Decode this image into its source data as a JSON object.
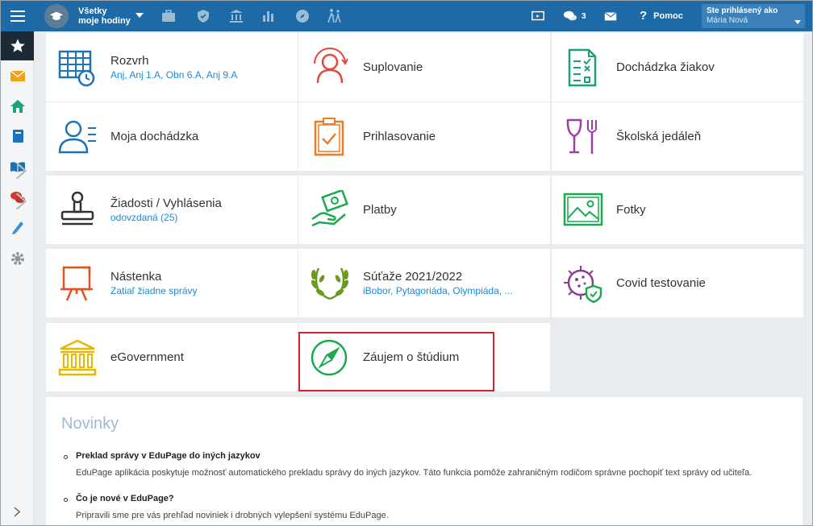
{
  "topbar": {
    "school_line1": "Všetky",
    "school_line2": "moje hodiny",
    "messages_count": "3",
    "help_label": "Pomoc",
    "login_label": "Ste prihlásený ako",
    "user_name": "Mária Nová"
  },
  "tiles": [
    {
      "title": "Rozvrh",
      "subtitle": "Anj, Anj 1.A, Obn 6.A, Anj 9.A",
      "icon": "timetable-icon",
      "color": "#1c72b8"
    },
    {
      "title": "Suplovanie",
      "subtitle": "",
      "icon": "substitution-icon",
      "color": "#e04b3f"
    },
    {
      "title": "Dochádzka žiakov",
      "subtitle": "",
      "icon": "attendance-list-icon",
      "color": "#1aa27a"
    },
    {
      "title": "Moja dochádzka",
      "subtitle": "",
      "icon": "my-attendance-icon",
      "color": "#1c72b8"
    },
    {
      "title": "Prihlasovanie",
      "subtitle": "",
      "icon": "clipboard-check-icon",
      "color": "#e87d2a"
    },
    {
      "title": "Školská jedáleň",
      "subtitle": "",
      "icon": "canteen-icon",
      "color": "#9b3fa6"
    },
    {
      "title": "Žiadosti / Vyhlásenia",
      "subtitle": "odovzdaná (25)",
      "icon": "stamp-icon",
      "color": "#2c3338"
    },
    {
      "title": "Platby",
      "subtitle": "",
      "icon": "payment-icon",
      "color": "#1aa94f"
    },
    {
      "title": "Fotky",
      "subtitle": "",
      "icon": "photo-icon",
      "color": "#1aa94f"
    },
    {
      "title": "Nástenka",
      "subtitle": "Zatiaľ žiadne správy",
      "icon": "noticeboard-icon",
      "color": "#e0531e"
    },
    {
      "title": "Súťaže 2021/2022",
      "subtitle": "iBobor, Pytagoriáda, Olympiáda, ...",
      "icon": "laurel-icon",
      "color": "#6a9a1f"
    },
    {
      "title": "Covid testovanie",
      "subtitle": "",
      "icon": "covid-icon",
      "color": "#8a3d93"
    },
    {
      "title": "eGovernment",
      "subtitle": "",
      "icon": "government-building-icon",
      "color": "#e6b800"
    },
    {
      "title": "Záujem o štúdium",
      "subtitle": "",
      "icon": "compass-icon",
      "color": "#1aa94f"
    }
  ],
  "news": {
    "heading": "Novinky",
    "items": [
      {
        "title": "Preklad správy v EduPage do iných jazykov",
        "desc": "EduPage aplikácia poskytuje možnosť automatického prekladu správy do iných jazykov. Táto funkcia pomôže zahraničným rodičom správne pochopiť text správy od učiteľa."
      },
      {
        "title": "Čo je nové v EduPage?",
        "desc": "Pripravili sme pre vás prehľad noviniek i drobných vylepšení systému EduPage."
      }
    ]
  }
}
